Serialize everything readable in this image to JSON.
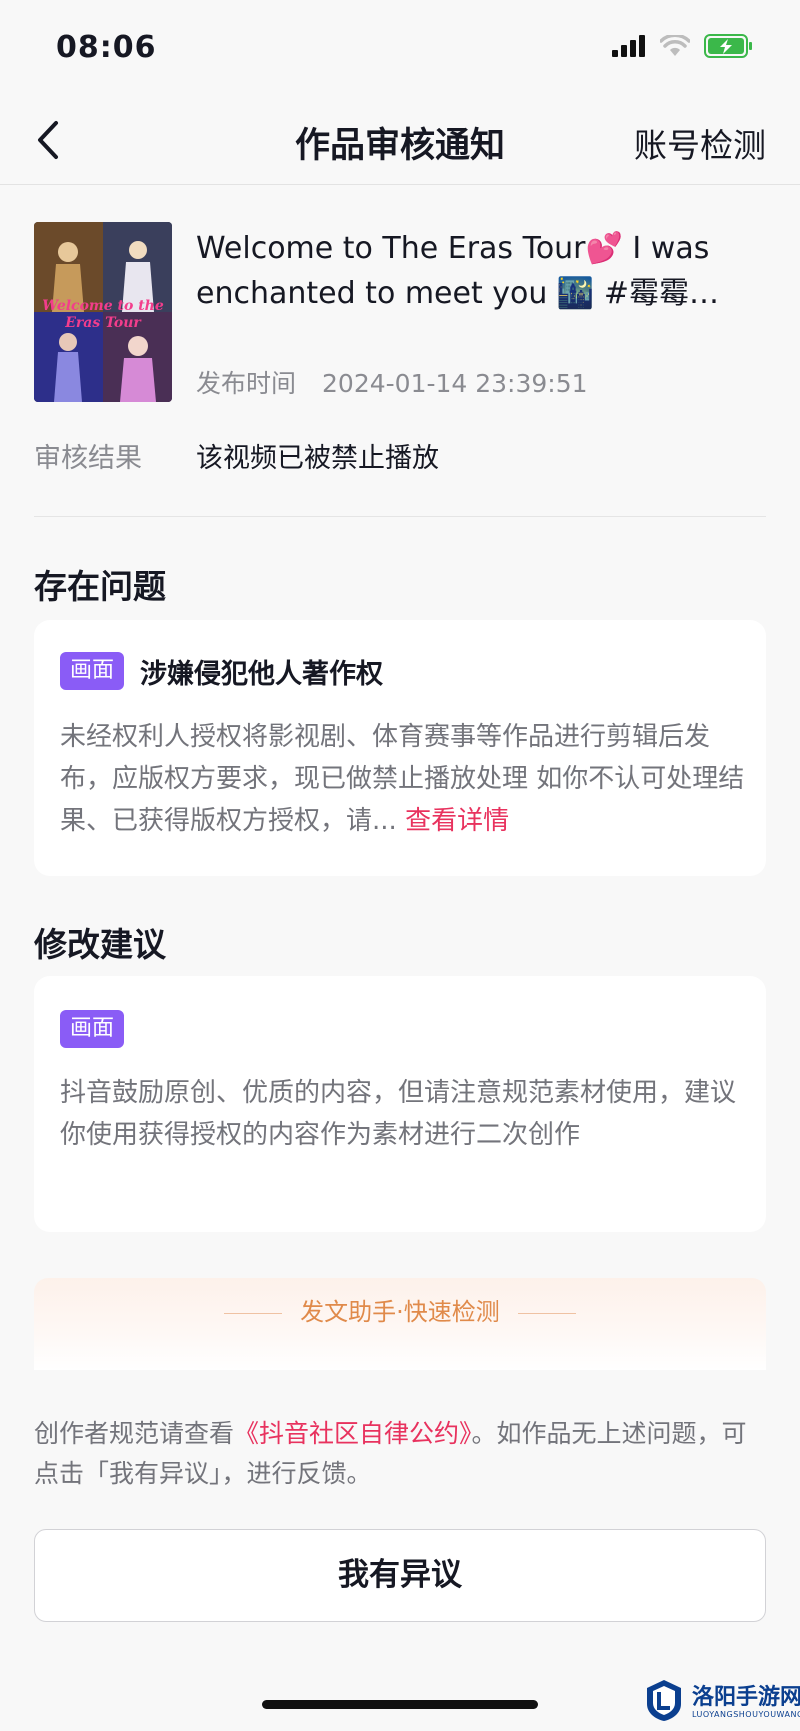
{
  "status_bar": {
    "time": "08:06"
  },
  "nav": {
    "title": "作品审核通知",
    "action": "账号检测"
  },
  "video": {
    "thumbnail_caption_line1": "Welcome to the",
    "thumbnail_caption_line2": "Eras Tour",
    "title": "Welcome to The Eras Tour💕 I was enchanted to meet you 🌃 #霉霉…",
    "publish_label": "发布时间",
    "publish_time": "2024-01-14 23:39:51"
  },
  "review": {
    "label": "审核结果",
    "value": "该视频已被禁止播放"
  },
  "issues": {
    "section_title": "存在问题",
    "tag": "画面",
    "title": "涉嫌侵犯他人著作权",
    "body": "未经权利人授权将影视剧、体育赛事等作品进行剪辑后发布，应版权方要求，现已做禁止播放处理 如你不认可处理结果、已获得版权方授权，请...",
    "detail_link": "查看详情"
  },
  "suggestions": {
    "section_title": "修改建议",
    "tag": "画面",
    "body": "抖音鼓励原创、优质的内容，但请注意规范素材使用，建议你使用获得授权的内容作为素材进行二次创作"
  },
  "assistant": {
    "title": "发文助手·快速检测"
  },
  "footnote": {
    "prefix": "创作者规范请查看",
    "link": "《抖音社区自律公约》",
    "suffix": "。如作品无上述问题，可点击「我有异议」，进行反馈。"
  },
  "objection_button": "我有异议",
  "watermark": {
    "name": "洛阳手游网",
    "sub": "LUOYANGSHOUYOUWANG"
  },
  "colors": {
    "accent_red": "#e8325e",
    "tag_purple": "#8a5cf6",
    "assist_orange": "#e08a4a"
  },
  "icons": [
    "signal-icon",
    "wifi-icon",
    "battery-charging-icon",
    "back-arrow-icon"
  ]
}
